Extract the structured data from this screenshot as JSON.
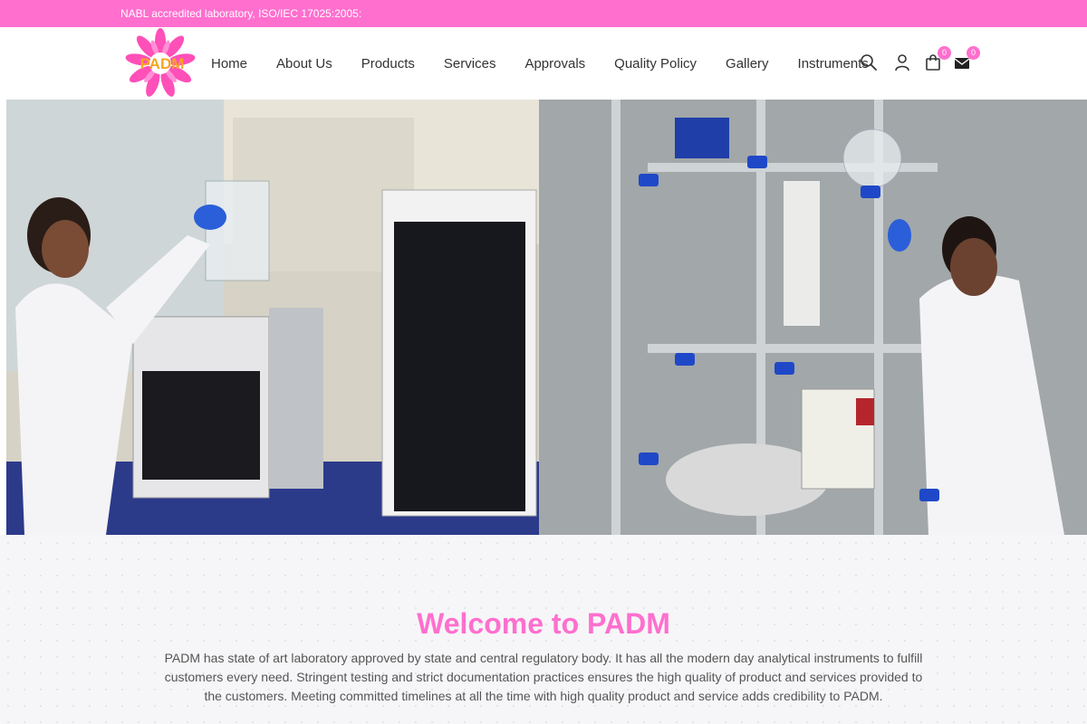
{
  "topbar": {
    "text": "NABL accredited laboratory, ISO/IEC 17025:2005:"
  },
  "logo": {
    "text": "PADM",
    "icon": "lotus-logo"
  },
  "nav": {
    "items": [
      "Home",
      "About Us",
      "Products",
      "Services",
      "Approvals",
      "Quality Policy",
      "Gallery",
      "Instruments"
    ]
  },
  "header_icons": {
    "search": "search-icon",
    "account": "user-icon",
    "cart": {
      "icon": "bag-icon",
      "count": "0"
    },
    "mail": {
      "icon": "envelope-icon",
      "count": "0"
    }
  },
  "hero": {
    "left": "lab-scientist-image",
    "right": "glass-reactor-image"
  },
  "welcome": {
    "title": "Welcome to PADM",
    "text": "PADM has state of art laboratory approved by state and central regulatory body. It has all the modern day analytical instruments to fulfill customers every need. Stringent testing and strict documentation practices ensures the high quality of product and services provided to the customers. Meeting committed timelines at all the time with high quality product and service adds credibility to PADM."
  },
  "colors": {
    "accent": "#ff6fce",
    "text": "#333333"
  }
}
